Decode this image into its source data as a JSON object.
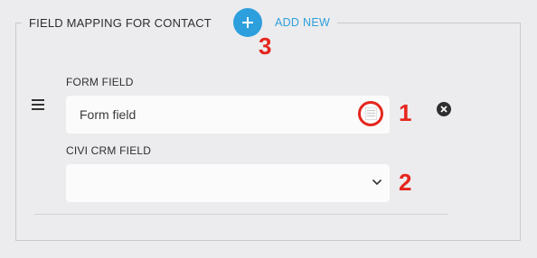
{
  "fieldset": {
    "title": "FIELD MAPPING FOR CONTACT",
    "add_new_label": "ADD NEW"
  },
  "mapping_row": {
    "form_field_label": "FORM FIELD",
    "form_field_value": "Form field",
    "crm_field_label": "CIVI CRM FIELD",
    "crm_field_value": ""
  },
  "callouts": {
    "one": "1",
    "two": "2",
    "three": "3"
  },
  "colors": {
    "accent": "#2d9fdc",
    "callout": "#e5261d",
    "background": "#ececee"
  },
  "icons": [
    "plus-icon",
    "drag-handle-icon",
    "list-icon",
    "close-circle-icon",
    "chevron-down-icon"
  ]
}
